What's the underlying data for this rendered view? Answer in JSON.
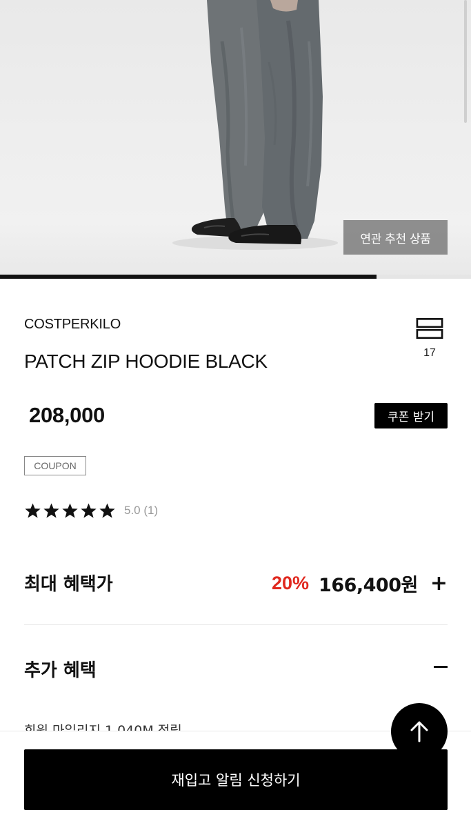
{
  "hero": {
    "related_button_label": "연관 추천 상품",
    "image_progress": 0.8
  },
  "product": {
    "brand": "COSTPERKILO",
    "name": "PATCH ZIP HOODIE BLACK",
    "price": "208,000",
    "coupon_button_label": "쿠폰 받기",
    "coupon_badge": "COUPON",
    "rating_stars": 5,
    "rating_text": "5.0 (1)",
    "list_count": "17"
  },
  "benefits": {
    "max_label": "최대 혜택가",
    "discount": "20%",
    "final_price": "166,400원",
    "extra_label": "추가 혜택",
    "peek_text": "회원 마일리지 1,040M 적립"
  },
  "footer": {
    "restock_button_label": "재입고 알림 신청하기"
  },
  "colors": {
    "accent_red": "#e0281e",
    "primary_black": "#000000"
  },
  "icons": {
    "list": "list-toggle-icon",
    "star": "star-icon",
    "plus": "plus-icon",
    "minus": "minus-icon",
    "top": "arrow-up-icon"
  }
}
